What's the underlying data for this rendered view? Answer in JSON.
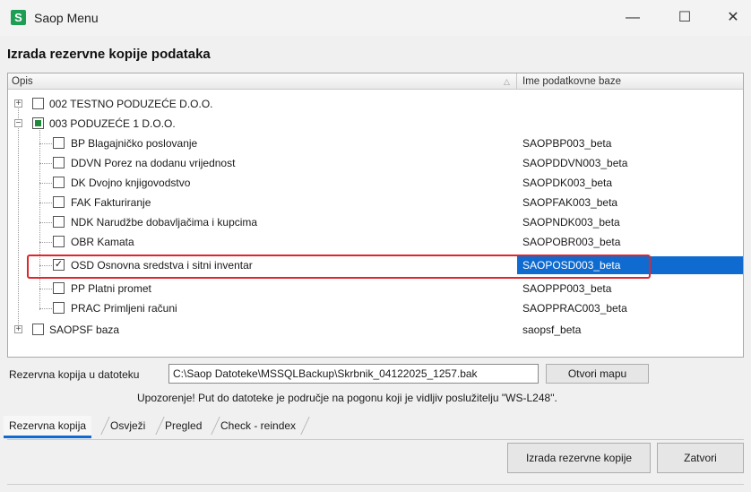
{
  "window": {
    "app_icon": "S",
    "title": "Saop Menu",
    "minimize": "—",
    "maximize": "☐",
    "close": "✕"
  },
  "page": {
    "heading": "Izrada rezervne kopije podataka"
  },
  "grid": {
    "columns": {
      "description": "Opis",
      "sort_indicator": "△",
      "database": "Ime podatkovne baze"
    },
    "rows": [
      {
        "label": "002 TESTNO PODUZEĆE D.O.O.",
        "db": "",
        "checked": false
      },
      {
        "label": "003 PODUZEĆE 1 D.O.O.",
        "db": "",
        "checked": "partial"
      },
      {
        "label": "BP Blagajničko poslovanje",
        "db": "SAOPBP003_beta",
        "checked": false
      },
      {
        "label": "DDVN Porez na dodanu vrijednost",
        "db": "SAOPDDVN003_beta",
        "checked": false
      },
      {
        "label": "DK Dvojno knjigovodstvo",
        "db": "SAOPDK003_beta",
        "checked": false
      },
      {
        "label": "FAK Fakturiranje",
        "db": "SAOPFAK003_beta",
        "checked": false
      },
      {
        "label": "NDK Narudžbe dobavljačima i kupcima",
        "db": "SAOPNDK003_beta",
        "checked": false
      },
      {
        "label": "OBR Kamata",
        "db": "SAOPOBR003_beta",
        "checked": false
      },
      {
        "label": "OSD Osnovna sredstva i sitni inventar",
        "db": "SAOPOSD003_beta",
        "checked": true,
        "selected": true
      },
      {
        "label": "PP Platni promet",
        "db": "SAOPPP003_beta",
        "checked": false
      },
      {
        "label": "PRAC Primljeni računi",
        "db": "SAOPPRAC003_beta",
        "checked": false
      },
      {
        "label": "SAOPSF baza",
        "db": "saopsf_beta",
        "checked": false
      }
    ],
    "expander_plus": "+",
    "expander_minus": "−",
    "check_mark": "✓"
  },
  "backup": {
    "label": "Rezervna kopija u datoteku",
    "path": "C:\\Saop Datoteke\\MSSQLBackup\\Skrbnik_04122025_1257.bak",
    "open_folder": "Otvori mapu",
    "warning": "Upozorenje! Put do datoteke je područje na pogonu koji je vidljiv poslužitelju \"WS-L248\"."
  },
  "tabs": [
    "Rezervna kopija",
    "Osvježi",
    "Pregled",
    "Check - reindex"
  ],
  "actions": {
    "create_backup": "Izrada rezervne kopije",
    "close": "Zatvori"
  },
  "colors": {
    "selection": "#0f6bd0",
    "highlight_border": "#e0262b",
    "app_icon": "#1e9e55"
  }
}
